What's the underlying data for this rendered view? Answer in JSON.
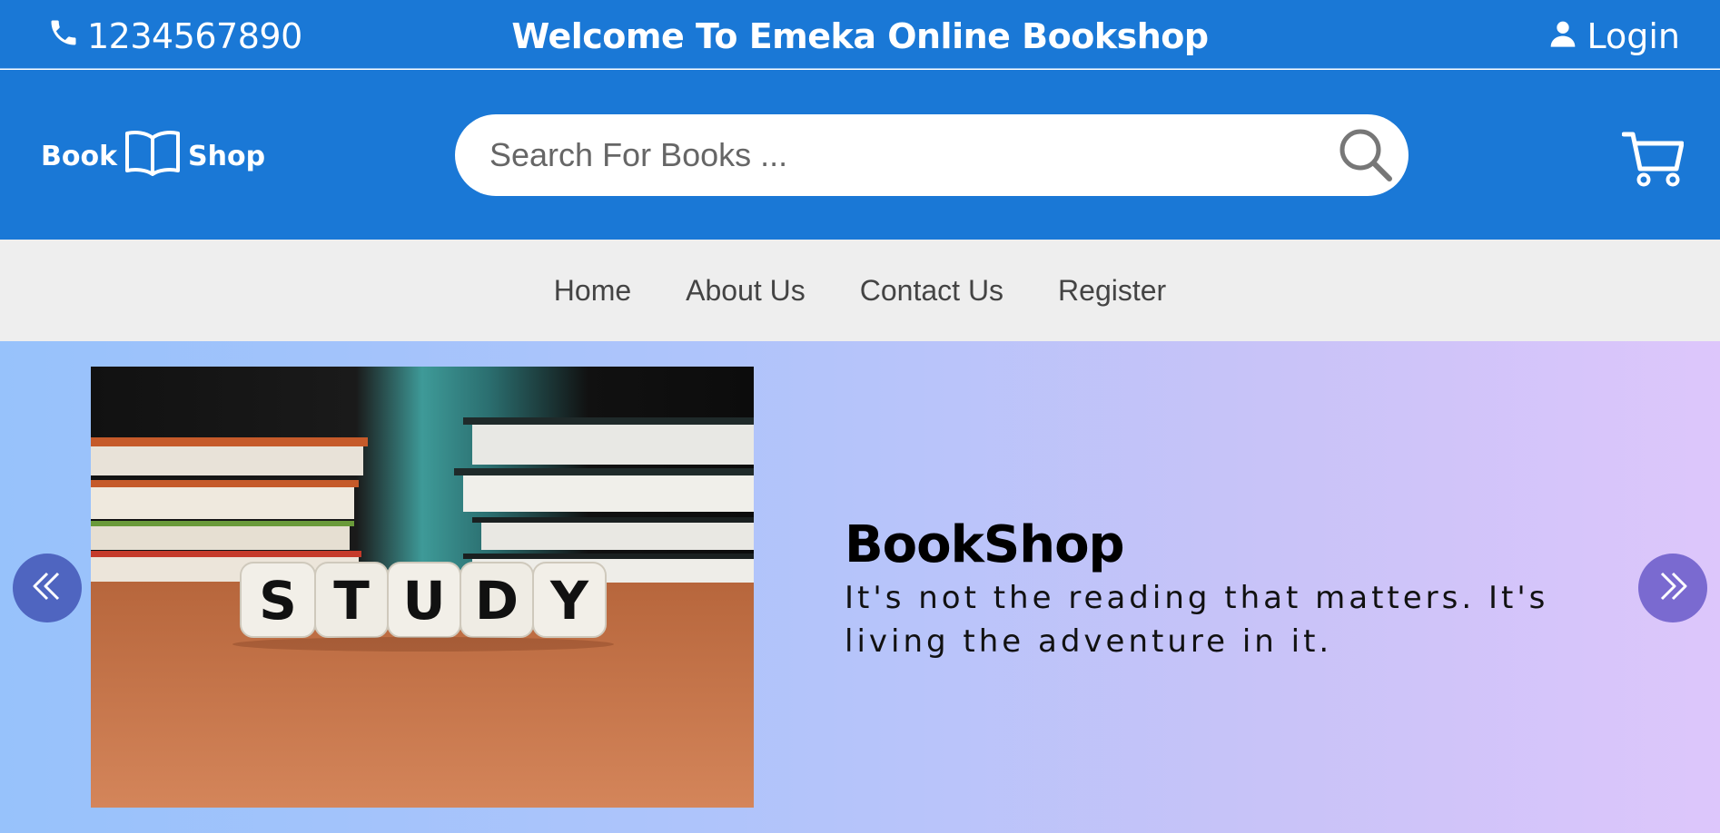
{
  "topbar": {
    "phone": "1234567890",
    "welcome": "Welcome To Emeka Online Bookshop",
    "login_label": "Login"
  },
  "header": {
    "logo_left": "Book",
    "logo_right": "Shop",
    "search_placeholder": "Search For Books ...",
    "search_value": ""
  },
  "nav": {
    "items": [
      {
        "label": "Home"
      },
      {
        "label": "About Us"
      },
      {
        "label": "Contact Us"
      },
      {
        "label": "Register"
      }
    ]
  },
  "hero": {
    "title": "BookShop",
    "quote": "It's not the reading that matters. It's living the adventure in it.",
    "image_text": "STUDY"
  },
  "icons": {
    "phone": "phone-icon",
    "user": "user-icon",
    "book": "book-open-icon",
    "search": "search-icon",
    "cart": "cart-icon",
    "prev": "chevron-double-left-icon",
    "next": "chevron-double-right-icon"
  },
  "colors": {
    "brand": "#1a78d6",
    "nav_bg": "#eeeeee",
    "hero_gradient_start": "#97c2fb",
    "hero_gradient_end": "#ddc6fb",
    "carousel_button": "#4f65c0"
  }
}
